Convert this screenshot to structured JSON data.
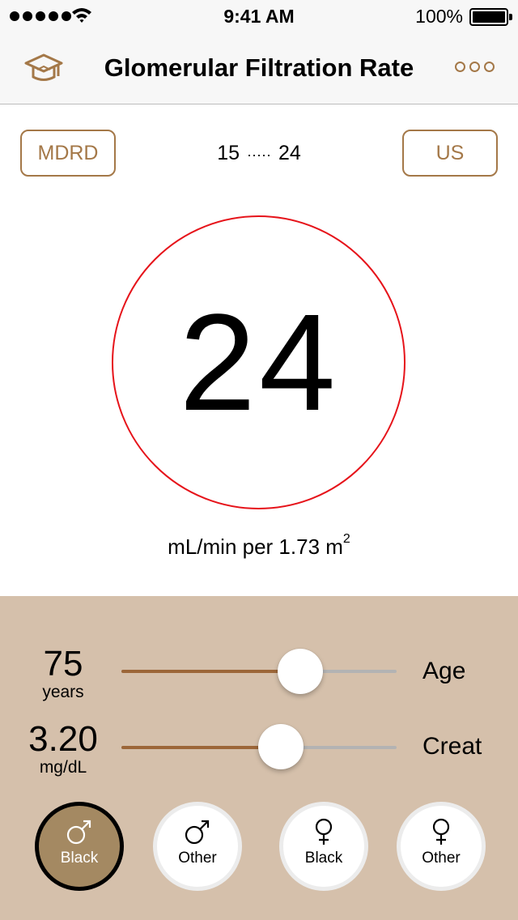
{
  "status_bar": {
    "time": "9:41 AM",
    "battery": "100%"
  },
  "nav": {
    "title": "Glomerular Filtration Rate",
    "left_icon": "graduation-cap-icon",
    "right_icon": "more-icon"
  },
  "controls": {
    "formula_button": "MDRD",
    "units_button": "US",
    "range_low": "15",
    "range_high": "24",
    "range_separator": "·····"
  },
  "result": {
    "value": "24",
    "units": "mL/min per 1.73 m",
    "units_exponent": "2",
    "ring_color": "#e6131a"
  },
  "sliders": [
    {
      "value": "75",
      "unit": "years",
      "label": "Age",
      "level": 0.65
    },
    {
      "value": "3.20",
      "unit": "mg/dL",
      "label": "Creat",
      "level": 0.58
    }
  ],
  "groups": [
    {
      "symbol": "male-icon",
      "label": "Black",
      "selected": true
    },
    {
      "symbol": "male-icon",
      "label": "Other",
      "selected": false
    },
    {
      "symbol": "female-icon",
      "label": "Black",
      "selected": false
    },
    {
      "symbol": "female-icon",
      "label": "Other",
      "selected": false
    }
  ],
  "colors": {
    "accent": "#a47848",
    "panel": "#d5c0ab",
    "slider_fill": "#9c6638",
    "selected_group": "#a48962"
  }
}
